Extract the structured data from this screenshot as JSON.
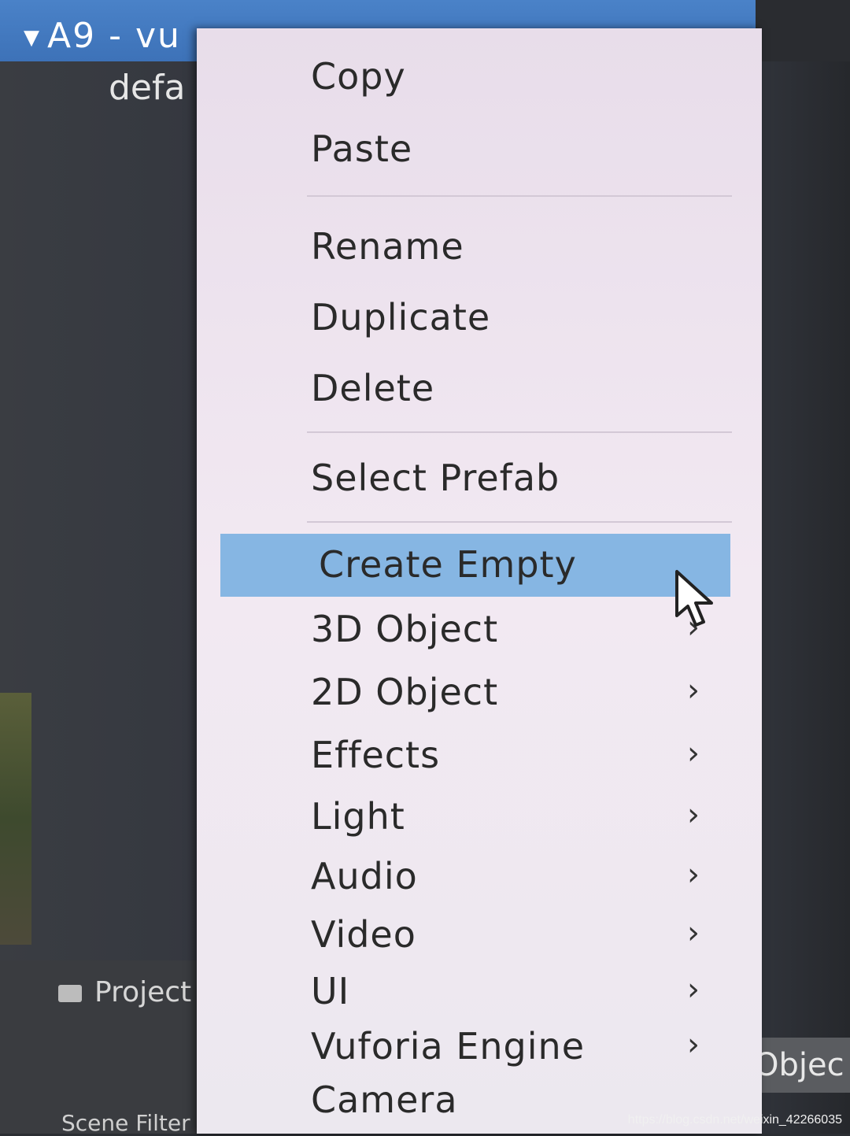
{
  "hierarchy": {
    "root_item": "A9 - vu",
    "child_item": "defa"
  },
  "panels": {
    "project_tab": "Project",
    "scene_filter": "Scene Filter",
    "object_button": "Objec"
  },
  "context_menu": {
    "items": [
      {
        "label": "Copy",
        "submenu": false
      },
      {
        "label": "Paste",
        "submenu": false
      },
      {
        "label": "Rename",
        "submenu": false
      },
      {
        "label": "Duplicate",
        "submenu": false
      },
      {
        "label": "Delete",
        "submenu": false
      },
      {
        "label": "Select Prefab",
        "submenu": false
      },
      {
        "label": "Create Empty",
        "submenu": false,
        "highlighted": true
      },
      {
        "label": "3D Object",
        "submenu": true
      },
      {
        "label": "2D Object",
        "submenu": true
      },
      {
        "label": "Effects",
        "submenu": true
      },
      {
        "label": "Light",
        "submenu": true
      },
      {
        "label": "Audio",
        "submenu": true
      },
      {
        "label": "Video",
        "submenu": true
      },
      {
        "label": "UI",
        "submenu": true
      },
      {
        "label": "Vuforia Engine",
        "submenu": true
      },
      {
        "label": "Camera",
        "submenu": false
      }
    ],
    "chevron": "›"
  },
  "watermark": "https://blog.csdn.net/weixin_42266035",
  "colors": {
    "menu_bg": "#f2e9f2",
    "highlight": "#86b6e3",
    "title_bar": "#4a82c8"
  },
  "icons": {
    "expand": "triangle-down-icon",
    "project": "folder-icon",
    "pointer": "mouse-pointer-icon"
  }
}
